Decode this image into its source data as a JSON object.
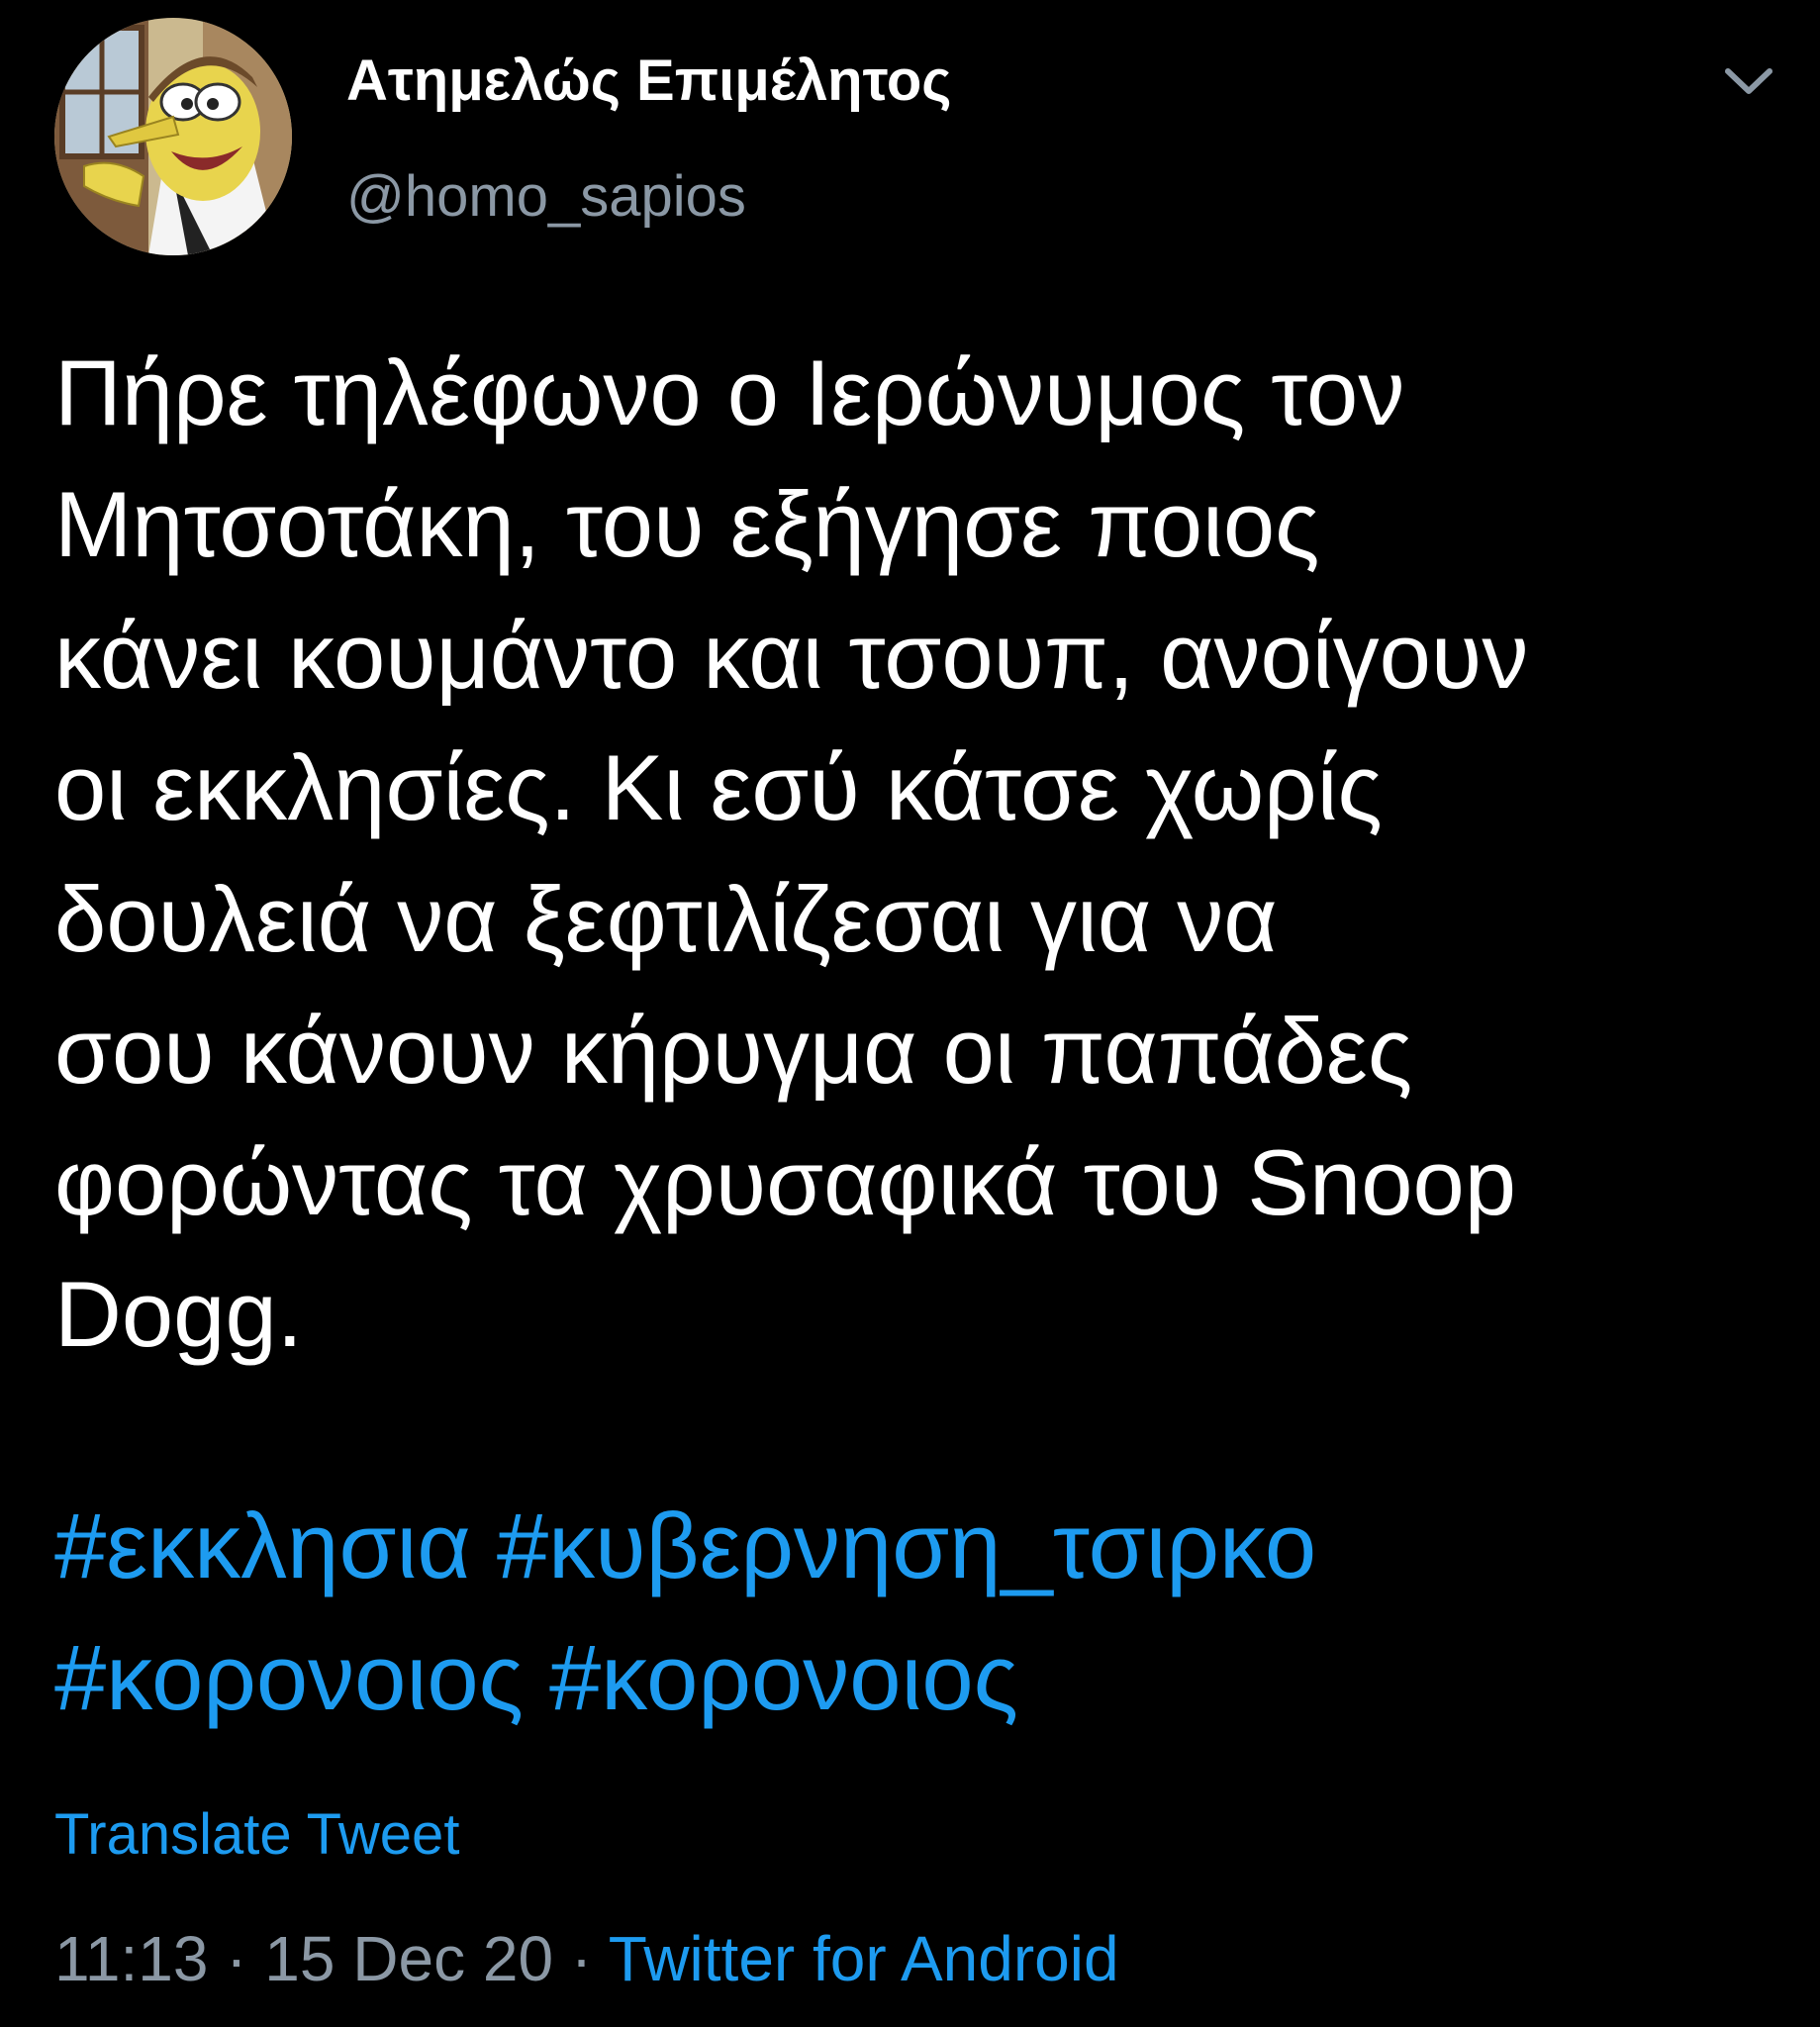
{
  "author": {
    "display_name": "Ατημελώς Επιμέλητος",
    "handle": "@homo_sapios",
    "avatar_icon": "cartoon-scientist-avatar"
  },
  "tweet": {
    "text_lines": [
      "Πήρε τηλέφωνο ο Ιερώνυμος τον",
      "Μητσοτάκη, του εξήγησε ποιος",
      "κάνει κουμάντο και τσουπ, ανοίγουν",
      "οι εκκλησίες. Κι εσύ κάτσε χωρίς",
      "δουλειά να ξεφτιλίζεσαι για να",
      "σου κάνουν κήρυγμα οι παπάδες",
      "φορώντας τα χρυσαφικά του Snoop",
      "Dogg."
    ],
    "hashtags": [
      "#εκκλησια",
      "#κυβερνηση_τσιρκο",
      "#κορονοιος",
      "#κορονοιος"
    ],
    "translate_label": "Translate Tweet",
    "time": "11:13",
    "separator": "·",
    "date": "15 Dec 20",
    "source": "Twitter for Android"
  },
  "colors": {
    "background": "#000000",
    "text": "#ffffff",
    "secondary": "#8b98a5",
    "accent": "#1d9bf0"
  },
  "icons": {
    "menu": "chevron-down-icon"
  }
}
